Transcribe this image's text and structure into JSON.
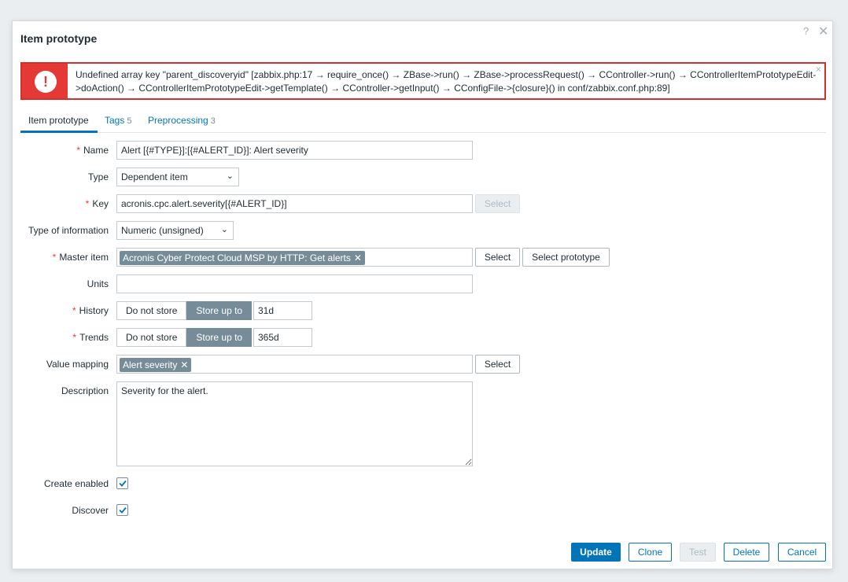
{
  "dialog": {
    "title": "Item prototype",
    "help_icon": "?",
    "close_icon": "✕"
  },
  "error": {
    "icon": "!",
    "message": "Undefined array key \"parent_discoveryid\" [zabbix.php:17 → require_once() → ZBase->run() → ZBase->processRequest() → CController->run() → CControllerItemPrototypeEdit->doAction() → CControllerItemPrototypeEdit->getTemplate() → CController->getInput() → CConfigFile->{closure}() in conf/zabbix.conf.php:89]",
    "close": "×"
  },
  "tabs": [
    {
      "label": "Item prototype",
      "count": ""
    },
    {
      "label": "Tags",
      "count": "5"
    },
    {
      "label": "Preprocessing",
      "count": "3"
    }
  ],
  "form": {
    "required_mark": "*",
    "name": {
      "label": "Name",
      "value": "Alert [{#TYPE}]:[{#ALERT_ID}]: Alert severity"
    },
    "type": {
      "label": "Type",
      "value": "Dependent item",
      "chevron": "⌄"
    },
    "key": {
      "label": "Key",
      "value": "acronis.cpc.alert.severity[{#ALERT_ID}]",
      "select": "Select"
    },
    "type_of_information": {
      "label": "Type of information",
      "value": "Numeric (unsigned)",
      "chevron": "⌄"
    },
    "master_item": {
      "label": "Master item",
      "tag": "Acronis Cyber Protect Cloud MSP by HTTP: Get alerts",
      "tag_remove": "✕",
      "select": "Select",
      "select_prototype": "Select prototype"
    },
    "units": {
      "label": "Units",
      "value": ""
    },
    "history": {
      "label": "History",
      "opt_no": "Do not store",
      "opt_yes": "Store up to",
      "value": "31d"
    },
    "trends": {
      "label": "Trends",
      "opt_no": "Do not store",
      "opt_yes": "Store up to",
      "value": "365d"
    },
    "value_mapping": {
      "label": "Value mapping",
      "tag": "Alert severity",
      "tag_remove": "✕",
      "select": "Select"
    },
    "description": {
      "label": "Description",
      "value": "Severity for the alert."
    },
    "create_enabled": {
      "label": "Create enabled",
      "checked": true
    },
    "discover": {
      "label": "Discover",
      "checked": true
    }
  },
  "footer": {
    "update": "Update",
    "clone": "Clone",
    "test": "Test",
    "delete": "Delete",
    "cancel": "Cancel"
  },
  "colors": {
    "accent": "#0275b8",
    "error": "#e53935",
    "tag_bg": "#768d99"
  }
}
